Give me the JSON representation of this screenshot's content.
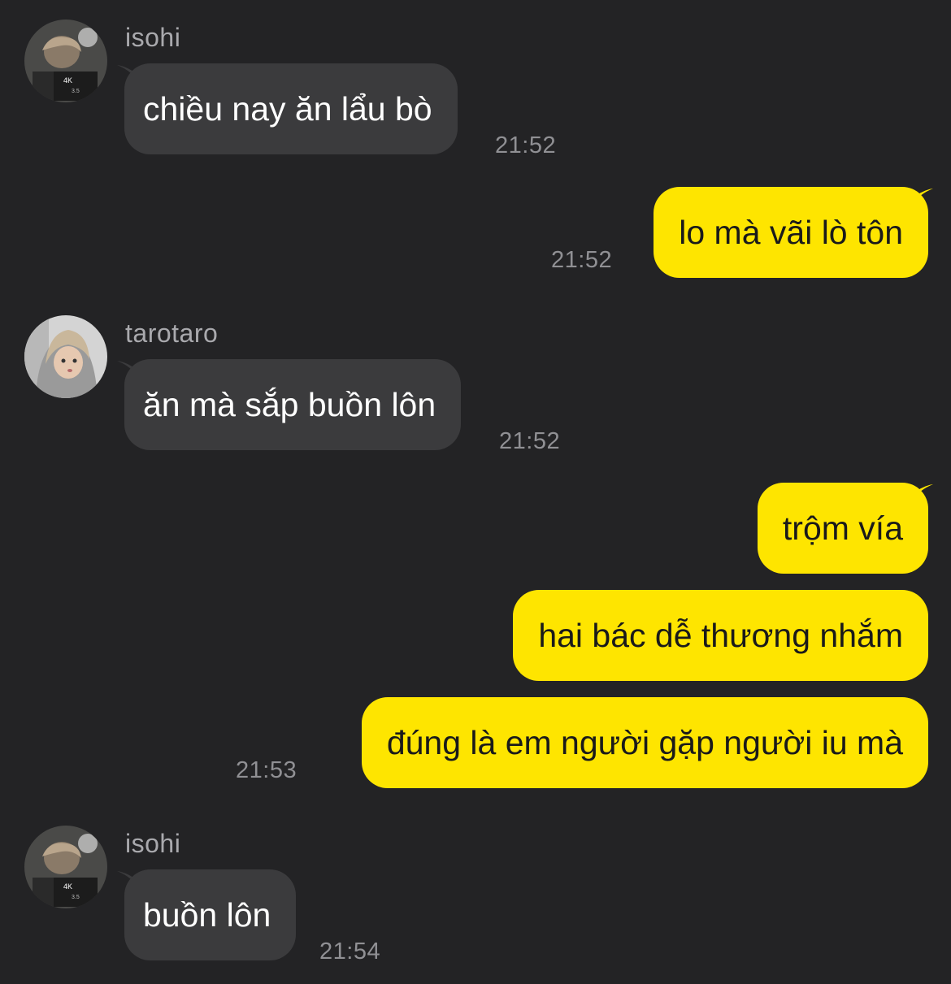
{
  "colors": {
    "background": "#232325",
    "incoming_bubble": "#3b3b3d",
    "outgoing_bubble": "#fee500",
    "sender_text": "#a9a9ad",
    "timestamp_text": "#909094"
  },
  "messages": [
    {
      "sender": "isohi",
      "text": "chiều nay ăn lẩu bò",
      "time": "21:52",
      "direction": "incoming"
    },
    {
      "text": "lo mà vãi lò tôn",
      "time": "21:52",
      "direction": "outgoing"
    },
    {
      "sender": "tarotaro",
      "text": "ăn mà sắp buồn lôn",
      "time": "21:52",
      "direction": "incoming"
    },
    {
      "text": "trộm vía",
      "direction": "outgoing"
    },
    {
      "text": "hai bác dễ thương nhắm",
      "direction": "outgoing"
    },
    {
      "text": "đúng là em người gặp người iu mà",
      "time": "21:53",
      "direction": "outgoing"
    },
    {
      "sender": "isohi",
      "text": "buồn lôn",
      "time": "21:54",
      "direction": "incoming"
    }
  ]
}
